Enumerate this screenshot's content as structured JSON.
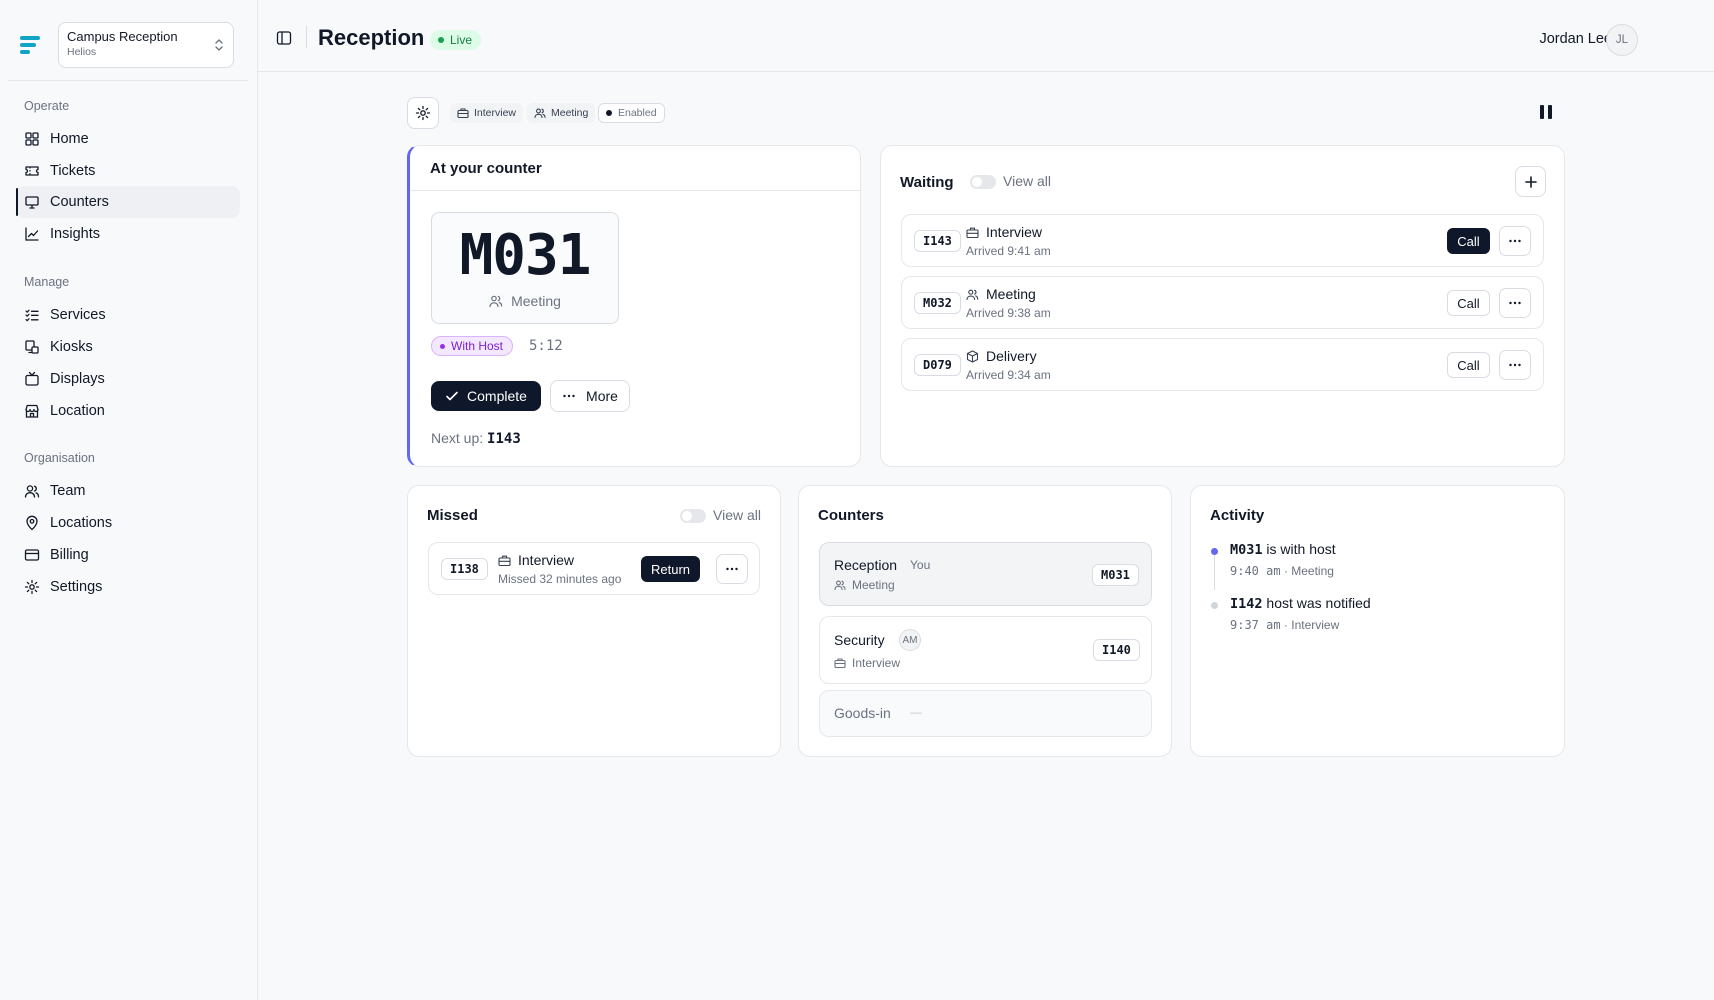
{
  "org": {
    "name": "Campus Reception",
    "sub": "Helios"
  },
  "nav": {
    "groups": [
      {
        "label": "Operate",
        "items": [
          {
            "label": "Home",
            "icon": "home-icon"
          },
          {
            "label": "Tickets",
            "icon": "ticket-icon"
          },
          {
            "label": "Counters",
            "icon": "monitor-icon",
            "active": true
          },
          {
            "label": "Insights",
            "icon": "chart-line-icon"
          }
        ]
      },
      {
        "label": "Manage",
        "items": [
          {
            "label": "Services",
            "icon": "list-check-icon"
          },
          {
            "label": "Kiosks",
            "icon": "kiosk-icon"
          },
          {
            "label": "Displays",
            "icon": "tv-icon"
          },
          {
            "label": "Location",
            "icon": "store-icon"
          }
        ]
      },
      {
        "label": "Organisation",
        "items": [
          {
            "label": "Team",
            "icon": "users-icon"
          },
          {
            "label": "Locations",
            "icon": "map-pin-icon"
          },
          {
            "label": "Billing",
            "icon": "credit-card-icon"
          },
          {
            "label": "Settings",
            "icon": "gear-icon"
          }
        ]
      }
    ]
  },
  "header": {
    "title": "Reception",
    "status": "Live",
    "user_name": "Jordan Lee",
    "user_initials": "JL"
  },
  "toolbar": {
    "chips": [
      "Interview",
      "Meeting"
    ],
    "enabled_label": "Enabled"
  },
  "counter": {
    "title": "At your counter",
    "ticket": "M031",
    "service": "Meeting",
    "status": "With Host",
    "timer": "5:12",
    "complete_label": "Complete",
    "more_label": "More",
    "next_up_label": "Next up:",
    "next_up_ticket": "I143"
  },
  "waiting": {
    "title": "Waiting",
    "toggle_label": "View all",
    "rows": [
      {
        "code": "I143",
        "service": "Interview",
        "arrived": "Arrived 9:41 am",
        "call_label": "Call",
        "primary": true
      },
      {
        "code": "M032",
        "service": "Meeting",
        "arrived": "Arrived 9:38 am",
        "call_label": "Call"
      },
      {
        "code": "D079",
        "service": "Delivery",
        "arrived": "Arrived 9:34 am",
        "call_label": "Call"
      }
    ]
  },
  "missed": {
    "title": "Missed",
    "toggle_label": "View all",
    "rows": [
      {
        "code": "I138",
        "service": "Interview",
        "detail": "Missed 32 minutes ago",
        "return_label": "Return"
      }
    ]
  },
  "counters": {
    "title": "Counters",
    "rows": [
      {
        "name": "Reception",
        "tag": "You",
        "service": "Meeting",
        "ticket": "M031"
      },
      {
        "name": "Security",
        "initials": "AM",
        "service": "Interview",
        "ticket": "I140"
      },
      {
        "name": "Goods-in",
        "placeholder": "—"
      }
    ]
  },
  "activity": {
    "title": "Activity",
    "events": [
      {
        "ticket": "M031",
        "text": "is with host",
        "time": "9:40 am",
        "service": "· Meeting",
        "dot": "#6366f1"
      },
      {
        "ticket": "I142",
        "text": "host was notified",
        "time": "9:37 am",
        "service": "· Interview",
        "dot": "#d1d5db"
      }
    ]
  }
}
